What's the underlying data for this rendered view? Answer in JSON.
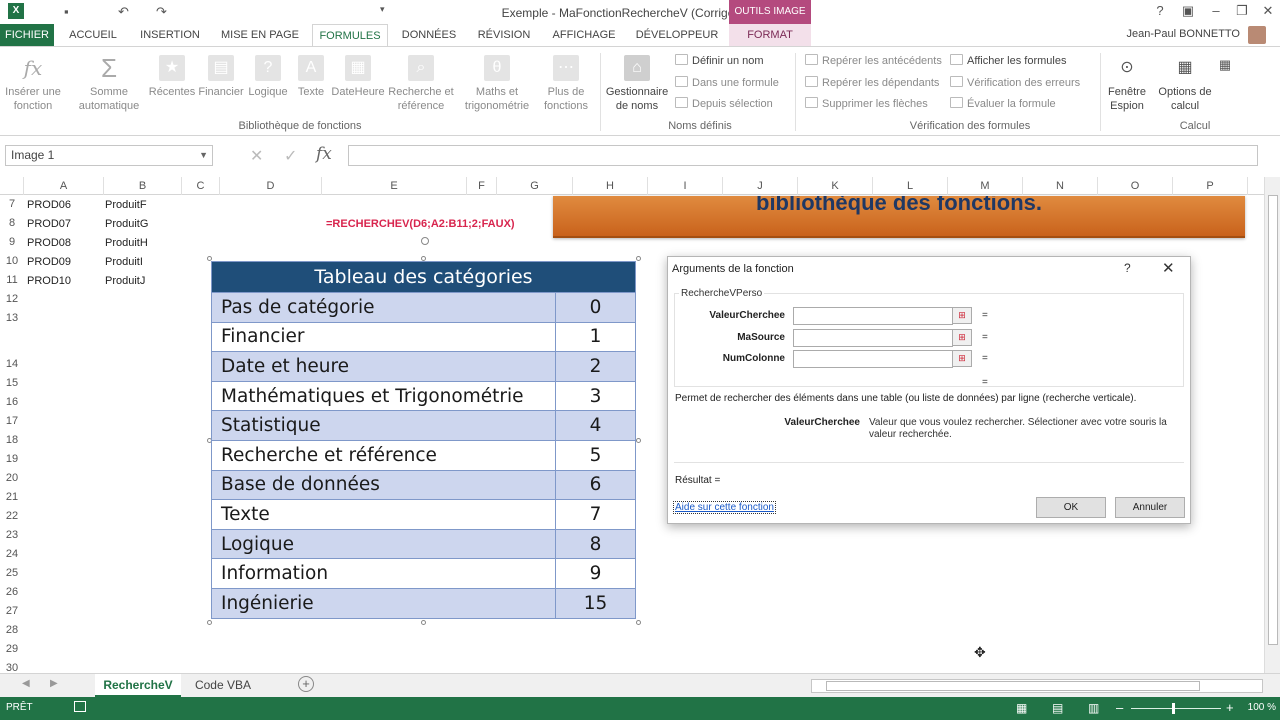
{
  "window": {
    "title": "Exemple - MaFonctionRechercheV (Corrigé) - Excel",
    "context_tab": "OUTILS IMAGE",
    "user": "Jean-Paul BONNETTO"
  },
  "tabs": [
    "FICHIER",
    "ACCUEIL",
    "INSERTION",
    "MISE EN PAGE",
    "FORMULES",
    "DONNÉES",
    "RÉVISION",
    "AFFICHAGE",
    "DÉVELOPPEUR",
    "FORMAT"
  ],
  "ribbon": {
    "insert_function": "Insérer une\nfonction",
    "autosum": "Somme\nautomatique",
    "recent": "Récentes",
    "financial": "Financier",
    "logical": "Logique",
    "text": "Texte",
    "datetime": "DateHeure",
    "lookup": "Recherche et\nréférence",
    "math": "Maths et\ntrigonométrie",
    "more": "Plus de\nfonctions",
    "group_library": "Bibliothèque de fonctions",
    "name_manager": "Gestionnaire\nde noms",
    "define_name": "Définir un nom",
    "use_in_formula": "Dans une formule",
    "create_from_selection": "Depuis sélection",
    "group_names": "Noms définis",
    "trace_precedents": "Repérer les antécédents",
    "trace_dependents": "Repérer les dépendants",
    "remove_arrows": "Supprimer les flèches",
    "show_formulas": "Afficher les formules",
    "error_checking": "Vérification des erreurs",
    "evaluate_formula": "Évaluer la formule",
    "group_auditing": "Vérification des formules",
    "watch_window": "Fenêtre\nEspion",
    "calc_options": "Options de\ncalcul",
    "group_calc": "Calcul"
  },
  "formula_bar": {
    "name_box": "Image 1",
    "fx": "fx"
  },
  "columns": [
    "A",
    "B",
    "C",
    "D",
    "E",
    "F",
    "G",
    "H",
    "I",
    "J",
    "K",
    "L",
    "M",
    "N",
    "O",
    "P"
  ],
  "rows": [
    "7",
    "8",
    "9",
    "10",
    "11",
    "12",
    "13",
    "14",
    "15",
    "16",
    "17",
    "18",
    "19",
    "20",
    "21",
    "22",
    "23",
    "24",
    "25",
    "26",
    "27",
    "28",
    "29",
    "30"
  ],
  "cells": [
    {
      "a": "PROD06",
      "b": "ProduitF"
    },
    {
      "a": "PROD07",
      "b": "ProduitG"
    },
    {
      "a": "PROD08",
      "b": "ProduitH"
    },
    {
      "a": "PROD09",
      "b": "ProduitI"
    },
    {
      "a": "PROD10",
      "b": "ProduitJ"
    }
  ],
  "formula_text": "=RECHERCHEV(D6;A2:B11;2;FAUX)",
  "banner_text": "bibliothèque des fonctions.",
  "category_table": {
    "title": "Tableau des catégories",
    "rows": [
      {
        "name": "Pas de catégorie",
        "code": "0"
      },
      {
        "name": "Financier",
        "code": "1"
      },
      {
        "name": "Date et heure",
        "code": "2"
      },
      {
        "name": "Mathématiques et Trigonométrie",
        "code": "3"
      },
      {
        "name": "Statistique",
        "code": "4"
      },
      {
        "name": "Recherche et référence",
        "code": "5"
      },
      {
        "name": "Base de données",
        "code": "6"
      },
      {
        "name": "Texte",
        "code": "7"
      },
      {
        "name": "Logique",
        "code": "8"
      },
      {
        "name": "Information",
        "code": "9"
      },
      {
        "name": "Ingénierie",
        "code": "15"
      }
    ]
  },
  "dialog": {
    "title": "Arguments de la fonction",
    "help": "?",
    "close": "✕",
    "function_name": "RechercheVPerso",
    "args": [
      {
        "label": "ValeurCherchee",
        "value": ""
      },
      {
        "label": "MaSource",
        "value": ""
      },
      {
        "label": "NumColonne",
        "value": ""
      }
    ],
    "equals": "=",
    "description": "Permet de rechercher des éléments dans une table (ou liste de données) par ligne (recherche verticale).",
    "current_arg": "ValeurCherchee",
    "current_arg_desc": "Valeur que vous voulez rechercher. Sélectioner avec votre souris la valeur recherchée.",
    "result_label": "Résultat =",
    "help_link": "Aide sur cette fonction",
    "ok": "OK",
    "cancel": "Annuler"
  },
  "sheets": [
    "RechercheV",
    "Code VBA"
  ],
  "status": {
    "ready": "PRÊT",
    "zoom": "100 %"
  },
  "colors": {
    "excel_green": "#217346",
    "table_header": "#1f4e79",
    "table_band": "#cdd6ee",
    "banner_orange": "#d9772c",
    "formula_red": "#d8254e"
  }
}
